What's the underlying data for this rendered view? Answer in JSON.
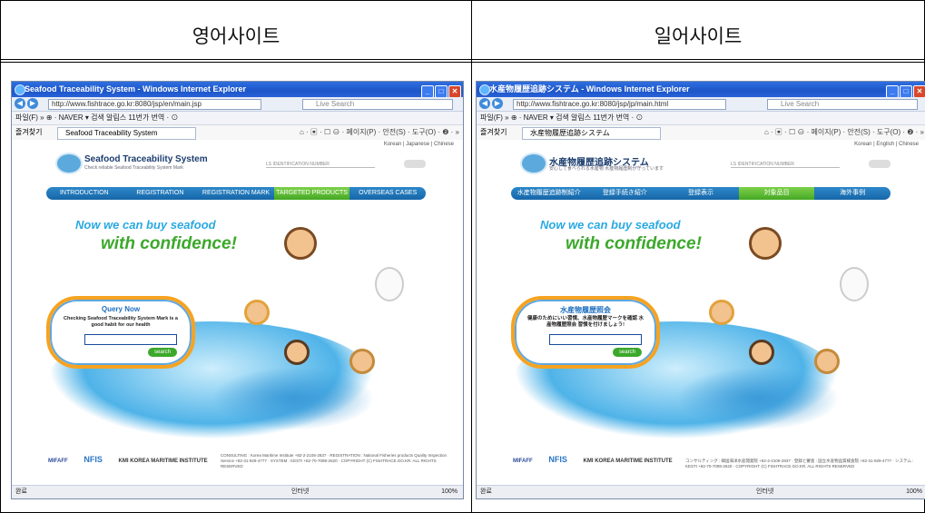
{
  "table": {
    "left_header": "영어사이트",
    "right_header": "일어사이트"
  },
  "left": {
    "window_title": "Seafood Traceability System - Windows Internet Explorer",
    "address": "http://www.fishtrace.go.kr:8080/jsp/en/main.jsp",
    "search_placeholder": "Live Search",
    "toolbar_text": "파일(F)  »  ⊕ ·  NAVER  ▾  검색  알림스  11번가  번역 · ⊙",
    "favorites": "즐겨찾기",
    "tab_label": "Seafood Traceability System",
    "right_tools": "⌂ · ▣ · ☐ ⊖ · 페이지(P) · 안전(S) · 도구(O) · ❷ · »",
    "langs": "Korean | Japanese | Chinese",
    "logo_title": "Seafood Traceability System",
    "logo_sub": "Check reliable Seafood Traceability System Mark",
    "id_label": "LS IDENTIFICATION NUMBER",
    "menu": [
      "INTRODUCTION",
      "REGISTRATION",
      "REGISTRATION MARK",
      "TARGETED PRODUCTS",
      "OVERSEAS CASES"
    ],
    "menu_highlight_index": 3,
    "tagline1": "Now we can buy seafood",
    "tagline2": "with confidence!",
    "query_title": "Query Now",
    "query_desc": "Checking Seafood Traceability System Mark is a good habit for our health",
    "query_button": "search",
    "footer_logos": [
      "MIFAFF",
      "NFIS",
      "KMI KOREA MARITIME INSTITUTE"
    ],
    "footer_info": "CONSULTING : Korea Maritime Institute +82-2-2105-2837 · REGISTRATION : National Fisheries products Quality Inspection Service +82-31-929-4777 · SYSTEM : KESTI +82-70-7098-2620 · COPYRIGHT (C) FISHTRACE.GO.KR. ALL RIGHTS RESERVED",
    "status_left": "완료",
    "status_mid": "인터넷",
    "status_right": "100%"
  },
  "right": {
    "window_title": "水産物履歴追跡システム - Windows Internet Explorer",
    "address": "http://www.fishtrace.go.kr:8080/jsp/jp/main.html",
    "search_placeholder": "Live Search",
    "toolbar_text": "파일(F)  »  ⊕ ·  NAVER  ▾  검색  알림스  11번가  번역 · ⊙",
    "favorites": "즐겨찾기",
    "tab_label": "水産物履歴追跡システム",
    "right_tools": "⌂ · ▣ · ☐ ⊖ · 페이지(P) · 안전(S) · 도구(O) · ❷ · »",
    "langs": "Korean | English | Chinese",
    "logo_title": "水産物履歴追跡システム",
    "logo_sub": "安心して食べられる水産物 水産物履歴制が守っています",
    "id_label": "LS IDENTIFICATION NUMBER",
    "menu": [
      "水産物履歴追跡制紹介",
      "登録手続き紹介",
      "登録表示",
      "対象品目",
      "海外事例"
    ],
    "menu_highlight_index": 3,
    "tagline1": "Now we can buy seafood",
    "tagline2": "with confidence!",
    "query_title": "水産物履歴照会",
    "query_desc": "健康のためにいい習慣、水産物履歴マークを確認 水産物履歴照会 習慣を付けましょう!",
    "query_button": "search",
    "footer_logos": [
      "MIFAFF",
      "NFIS",
      "KMI KOREA MARITIME INSTITUTE"
    ],
    "footer_info": "コンサルティング : 韓国海洋水産開発院 +82-2-2105-2837 · 登録と審査 : 国立水産物品質検査院 +82-31-929-4777 · システム : KESTI +82-70-7098-2620 · COPYRIGHT (C) FISHTRACE.GO.KR. ALL RIGHTS RESERVED",
    "status_left": "완료",
    "status_mid": "인터넷",
    "status_right": "100%"
  },
  "colors": {
    "titlebar": "#1c55c8",
    "menu_blue": "#1766a8",
    "menu_green": "#45a824",
    "tagline_blue": "#29a9e1",
    "tagline_green": "#3ca82b",
    "query_border": "#f6a321"
  }
}
